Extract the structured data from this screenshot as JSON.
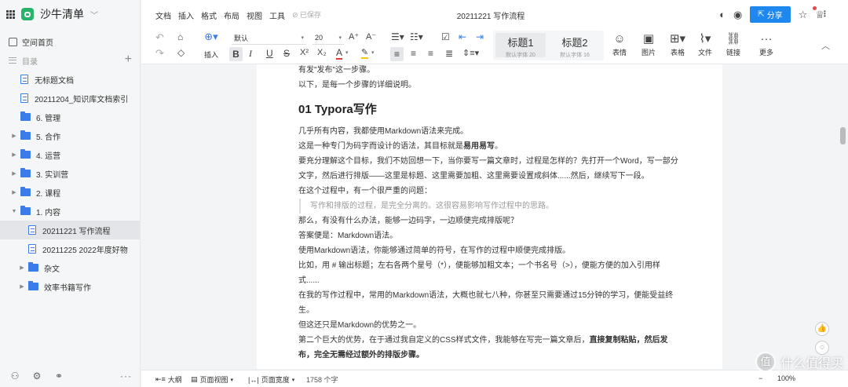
{
  "sidebar": {
    "brand": "沙牛清单",
    "home": "空间首页",
    "toc": "目录",
    "items": [
      {
        "label": "无标题文档",
        "type": "doc",
        "expand": ""
      },
      {
        "label": "20211204_知识库文档索引",
        "type": "doc",
        "expand": ""
      },
      {
        "label": "6. 管理",
        "type": "folder",
        "expand": ""
      },
      {
        "label": "5. 合作",
        "type": "folder",
        "expand": "▶"
      },
      {
        "label": "4. 运营",
        "type": "folder",
        "expand": "▶"
      },
      {
        "label": "3. 实训营",
        "type": "folder",
        "expand": "▶"
      },
      {
        "label": "2. 课程",
        "type": "folder",
        "expand": "▶"
      },
      {
        "label": "1. 内容",
        "type": "folder",
        "expand": "▼"
      },
      {
        "label": "20211221 写作流程",
        "type": "doc",
        "expand": ""
      },
      {
        "label": "20211225 2022年度好物",
        "type": "doc",
        "expand": ""
      },
      {
        "label": "杂文",
        "type": "folder",
        "expand": "▶"
      },
      {
        "label": "效率书籍写作",
        "type": "folder",
        "expand": "▶"
      }
    ]
  },
  "header": {
    "menus": [
      "文档",
      "插入",
      "格式",
      "布局",
      "视图",
      "工具"
    ],
    "saved": "已保存",
    "title": "20211221 写作流程",
    "share": "分享"
  },
  "toolbar": {
    "insert": "插入",
    "font": "默认",
    "size": "20",
    "h1": "标题1",
    "h1_count": "默认字体 20",
    "h2": "标题2",
    "h2_count": "默认字体 16",
    "emoji": "表情",
    "image": "图片",
    "table": "表格",
    "file": "文件",
    "link": "链接",
    "more": "更多"
  },
  "doc": {
    "pre1": "有发\"发布\"这一步骤。",
    "pre2": "以下，是每一个步骤的详细说明。",
    "heading": "01 Typora写作",
    "p1": "几乎所有内容，我都使用Markdown语法来完成。",
    "p2a": "这是一种专门为码字而设计的语法，其目标就是",
    "p2b": "易用易写",
    "p2c": "。",
    "p3": "要充分理解这个目标，我们不妨回想一下，当你要写一篇文章时，过程是怎样的？先打开一个Word，写一部分文字，然后进行排版——这里是标题、这里需要加粗、这里需要设置成斜体......然后，继续写下一段。",
    "p4": "在这个过程中，有一个很严重的问题：",
    "quote": "写作和排版的过程，是完全分离的。这很容易影响写作过程中的思路。",
    "p5": "那么，有没有什么办法，能够一边码字，一边顺便完成排版呢？",
    "p6": "答案便是：Markdown语法。",
    "p7": "使用Markdown语法，你能够通过简单的符号，在写作的过程中顺便完成排版。",
    "p8": "比如，用 # 输出标题；左右各两个星号（*），便能够加粗文本；一个书名号（>），便能方便的加入引用样式......",
    "p9": "在我的写作过程中，常用的Markdown语法，大概也就七八种，你甚至只需要通过15分钟的学习，便能受益终生。",
    "p10": "但这还只是Markdown的优势之一。",
    "p11a": "第二个巨大的优势，在于通过我自定义的CSS样式文件，我能够在写完一篇文章后，",
    "p11b": "直接复制粘贴，然后发布，完全无需经过额外的排版步骤。"
  },
  "status": {
    "outline": "大纲",
    "page_view": "页面视图",
    "page_width": "页面宽度",
    "word_count": "1758 个字",
    "zoom": "100%"
  },
  "watermark": {
    "text": "什么值得买",
    "mark": "值"
  }
}
